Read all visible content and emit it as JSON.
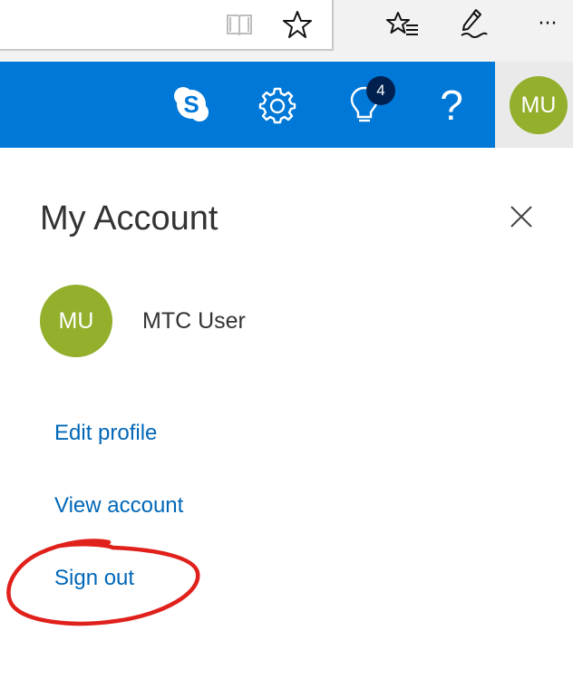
{
  "browser_toolbar": {
    "icons": [
      "reading-view-icon",
      "favorite-star-icon",
      "favorites-hub-icon",
      "web-note-pen-icon",
      "more-dots-icon"
    ],
    "more_label": "···"
  },
  "app_header": {
    "color": "#0078d7",
    "icons": [
      "skype-icon",
      "settings-gear-icon",
      "tips-lightbulb-icon",
      "help-question-icon"
    ],
    "help_label": "?",
    "notification_count": "4",
    "avatar_initials": "MU"
  },
  "account_panel": {
    "title": "My Account",
    "user": {
      "initials": "MU",
      "name": "MTC User",
      "avatar_color": "#93af2b"
    },
    "links": {
      "edit_profile": "Edit profile",
      "view_account": "View account",
      "sign_out": "Sign out"
    },
    "link_color": "#0067b8"
  },
  "annotation": {
    "shape": "red-hand-drawn-circle",
    "color": "#e0201b"
  }
}
